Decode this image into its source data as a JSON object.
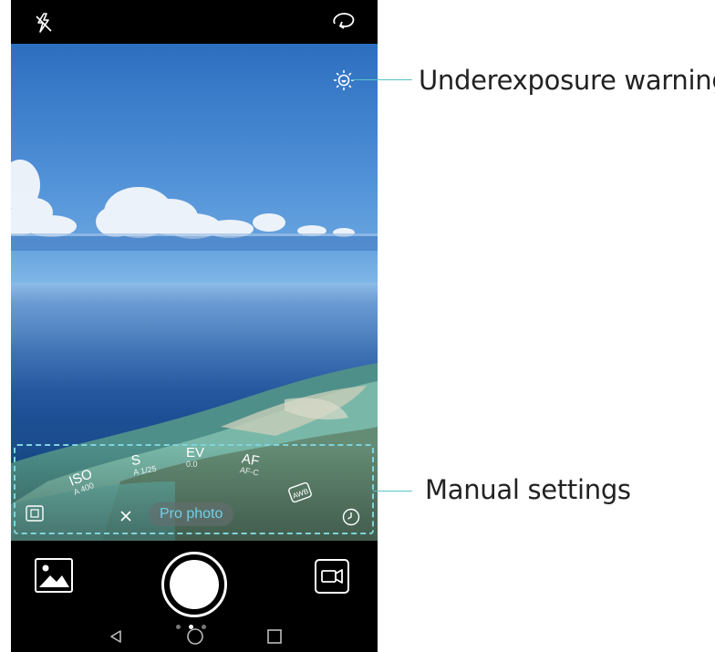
{
  "viewfinder": {
    "pro_settings": [
      {
        "name": "ISO",
        "value": "A 400"
      },
      {
        "name": "S",
        "value": "A 1/25"
      },
      {
        "name": "EV",
        "value": "0.0"
      },
      {
        "name": "AF",
        "value": "AF-C"
      }
    ],
    "mode_label": "Pro photo"
  },
  "callouts": {
    "underexposure": "Underexposure warning",
    "manual": "Manual settings"
  },
  "colors": {
    "accent": "#6fd0e6",
    "callout_line": "#5cc3c8"
  }
}
